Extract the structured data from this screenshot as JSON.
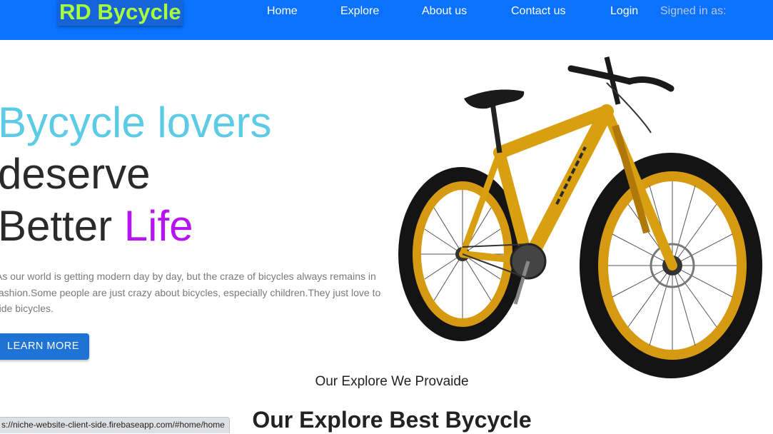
{
  "navbar": {
    "brand": "RD Bycycle",
    "links": [
      "Home",
      "Explore",
      "About us",
      "Contact us"
    ],
    "login": "Login",
    "signed_in": "Signed in as:",
    "background_color": "#0a72ff",
    "brand_color": "#a8ff3c"
  },
  "hero": {
    "line1": "Bycycle lovers",
    "line2": "deserve",
    "line3_prefix": "Better ",
    "line3_accent": "Life",
    "description": "As our world is getting modern day by day, but the craze of bicycles always remains in fashion.Some people are just crazy about bicycles, especially children.They just love to ride bicycles.",
    "button": "LEARN MORE",
    "line1_color": "#5ccbe6",
    "accent_color": "#b814f2",
    "image_icon": "fat-tire-bicycle"
  },
  "explore": {
    "subtitle": "Our Explore We Provaide",
    "title": "Our Explore Best Bycycle"
  },
  "status_bar": {
    "url": "s://niche-website-client-side.firebaseapp.com/#home/home"
  }
}
